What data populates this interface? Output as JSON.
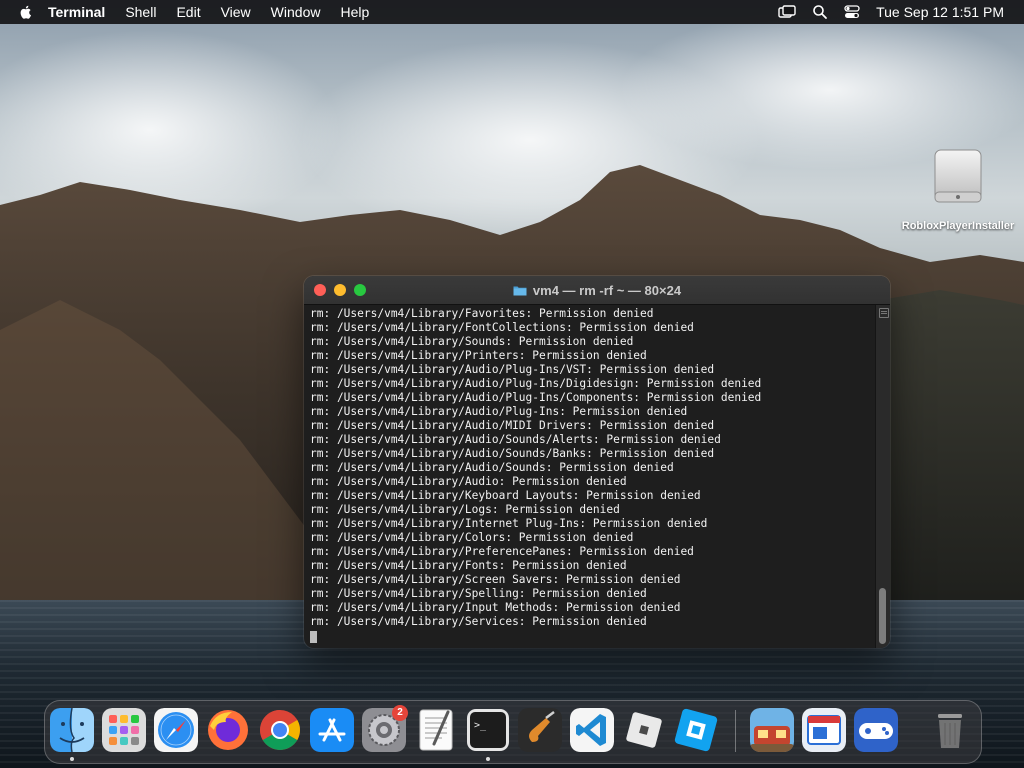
{
  "menubar": {
    "app_name": "Terminal",
    "items": [
      "Shell",
      "Edit",
      "View",
      "Window",
      "Help"
    ],
    "clock": "Tue Sep 12  1:51 PM"
  },
  "desktop": {
    "icon_label": "RobloxPlayerInstaller"
  },
  "terminal": {
    "title": "vm4 — rm -rf ~ — 80×24",
    "lines": [
      "rm: /Users/vm4/Library/Favorites: Permission denied",
      "rm: /Users/vm4/Library/FontCollections: Permission denied",
      "rm: /Users/vm4/Library/Sounds: Permission denied",
      "rm: /Users/vm4/Library/Printers: Permission denied",
      "rm: /Users/vm4/Library/Audio/Plug-Ins/VST: Permission denied",
      "rm: /Users/vm4/Library/Audio/Plug-Ins/Digidesign: Permission denied",
      "rm: /Users/vm4/Library/Audio/Plug-Ins/Components: Permission denied",
      "rm: /Users/vm4/Library/Audio/Plug-Ins: Permission denied",
      "rm: /Users/vm4/Library/Audio/MIDI Drivers: Permission denied",
      "rm: /Users/vm4/Library/Audio/Sounds/Alerts: Permission denied",
      "rm: /Users/vm4/Library/Audio/Sounds/Banks: Permission denied",
      "rm: /Users/vm4/Library/Audio/Sounds: Permission denied",
      "rm: /Users/vm4/Library/Audio: Permission denied",
      "rm: /Users/vm4/Library/Keyboard Layouts: Permission denied",
      "rm: /Users/vm4/Library/Logs: Permission denied",
      "rm: /Users/vm4/Library/Internet Plug-Ins: Permission denied",
      "rm: /Users/vm4/Library/Colors: Permission denied",
      "rm: /Users/vm4/Library/PreferencePanes: Permission denied",
      "rm: /Users/vm4/Library/Fonts: Permission denied",
      "rm: /Users/vm4/Library/Screen Savers: Permission denied",
      "rm: /Users/vm4/Library/Spelling: Permission denied",
      "rm: /Users/vm4/Library/Input Methods: Permission denied",
      "rm: /Users/vm4/Library/Services: Permission denied"
    ]
  },
  "dock": {
    "apps": [
      {
        "name": "finder-icon",
        "running": true
      },
      {
        "name": "launchpad-icon",
        "running": false
      },
      {
        "name": "safari-icon",
        "running": false
      },
      {
        "name": "firefox-icon",
        "running": false
      },
      {
        "name": "chrome-icon",
        "running": false
      },
      {
        "name": "app-store-icon",
        "running": false
      },
      {
        "name": "system-settings-icon",
        "running": false,
        "badge": "2"
      },
      {
        "name": "textedit-icon",
        "running": false
      },
      {
        "name": "terminal-icon",
        "running": true
      },
      {
        "name": "garageband-icon",
        "running": false
      },
      {
        "name": "vscode-icon",
        "running": false
      },
      {
        "name": "roblox-icon",
        "running": false
      },
      {
        "name": "roblox-studio-icon",
        "running": false
      },
      {
        "name": "game-app-icon",
        "running": false
      },
      {
        "name": "window-app-icon",
        "running": false
      },
      {
        "name": "controller-app-icon",
        "running": false
      },
      {
        "name": "trash-icon",
        "running": false
      }
    ]
  }
}
